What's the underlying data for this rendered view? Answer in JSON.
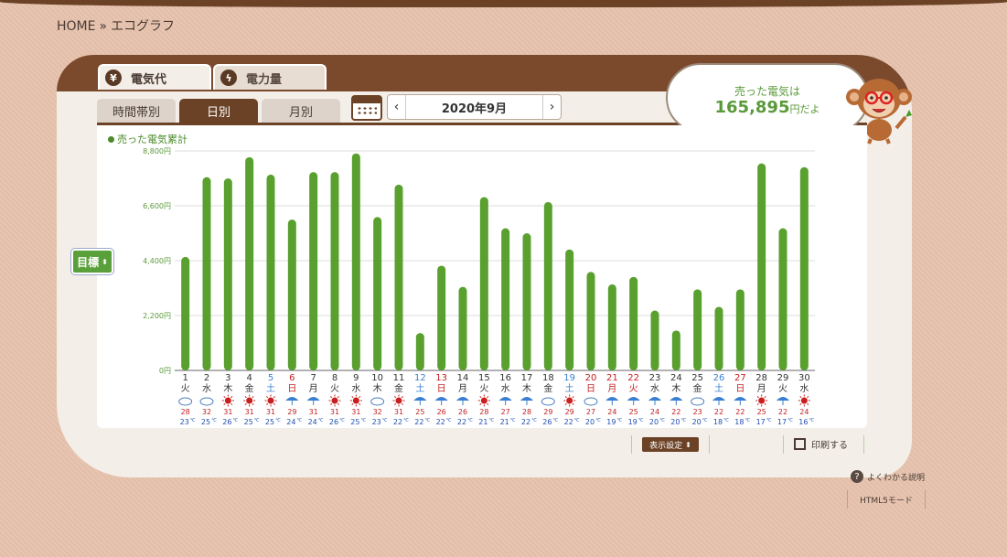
{
  "breadcrumb": {
    "home": "HOME",
    "sep": "»",
    "current": "エコグラフ"
  },
  "main_tabs": [
    {
      "label": "電気代",
      "icon": "yen-icon",
      "glyph": "¥"
    },
    {
      "label": "電力量",
      "icon": "lightning-icon",
      "glyph": "ϟ"
    }
  ],
  "sub_tabs": [
    {
      "label": "時間帯別"
    },
    {
      "label": "日別"
    },
    {
      "label": "月別"
    }
  ],
  "month_nav": {
    "prev": "‹",
    "label": "2020年9月",
    "next": "›"
  },
  "bubble": {
    "line1": "売った電気は",
    "amount": "165,895",
    "suffix": "円だよ"
  },
  "target_button": "目標",
  "legend": "売った電気累計",
  "bottom": {
    "display_settings": "表示設定",
    "print": "印刷する"
  },
  "help_link": "よくわかる説明",
  "html5_mode": "HTML5モード",
  "colors": {
    "bar": "#5aa02f",
    "brown": "#6b4226",
    "sat": "#3a7fd0",
    "sun": "#c21f1f"
  },
  "chart_data": {
    "type": "bar",
    "ylim": [
      0,
      8800
    ],
    "yticks": [
      "0円",
      "2,200円",
      "4,400円",
      "6,600円",
      "8,800円"
    ],
    "days": [
      "1",
      "2",
      "3",
      "4",
      "5",
      "6",
      "7",
      "8",
      "9",
      "10",
      "11",
      "12",
      "13",
      "14",
      "15",
      "16",
      "17",
      "18",
      "19",
      "20",
      "21",
      "22",
      "23",
      "24",
      "25",
      "26",
      "27",
      "28",
      "29",
      "30"
    ],
    "weekdays": [
      "火",
      "水",
      "木",
      "金",
      "土",
      "日",
      "月",
      "火",
      "水",
      "木",
      "金",
      "土",
      "日",
      "月",
      "火",
      "水",
      "木",
      "金",
      "土",
      "日",
      "月",
      "火",
      "水",
      "木",
      "金",
      "土",
      "日",
      "月",
      "火",
      "水"
    ],
    "day_types": [
      "n",
      "n",
      "n",
      "n",
      "sat",
      "sun",
      "n",
      "n",
      "n",
      "n",
      "n",
      "sat",
      "sun",
      "n",
      "n",
      "n",
      "n",
      "n",
      "sat",
      "hol",
      "hol",
      "hol",
      "n",
      "n",
      "n",
      "sat",
      "sun",
      "n",
      "n",
      "n"
    ],
    "values": [
      4550,
      7750,
      7700,
      8550,
      7850,
      6050,
      7950,
      7950,
      8700,
      6150,
      7450,
      1500,
      4200,
      3350,
      6950,
      5700,
      5500,
      6750,
      4850,
      3950,
      3450,
      3750,
      2400,
      1600,
      3250,
      2550,
      3250,
      8300,
      5700,
      8150
    ],
    "weather": [
      "cloud",
      "cloud",
      "sun",
      "sun",
      "sun",
      "umbrella",
      "umbrella",
      "sun",
      "sun",
      "cloud",
      "sun",
      "umbrella",
      "umbrella",
      "umbrella",
      "sun",
      "umbrella",
      "umbrella",
      "cloud",
      "sun",
      "cloud",
      "umbrella",
      "umbrella",
      "umbrella",
      "umbrella",
      "cloud",
      "umbrella",
      "umbrella",
      "sun",
      "umbrella",
      "sun"
    ],
    "temp_high": [
      "28",
      "32",
      "31",
      "31",
      "31",
      "29",
      "31",
      "31",
      "31",
      "32",
      "31",
      "25",
      "26",
      "26",
      "28",
      "27",
      "28",
      "29",
      "29",
      "27",
      "24",
      "25",
      "24",
      "22",
      "23",
      "22",
      "22",
      "25",
      "22",
      "24"
    ],
    "temp_low": [
      "23",
      "25",
      "26",
      "25",
      "25",
      "24",
      "24",
      "26",
      "25",
      "23",
      "22",
      "22",
      "22",
      "22",
      "21",
      "21",
      "22",
      "26",
      "22",
      "20",
      "19",
      "19",
      "20",
      "20",
      "20",
      "18",
      "18",
      "17",
      "17",
      "16"
    ],
    "temp_unit": "℃"
  }
}
